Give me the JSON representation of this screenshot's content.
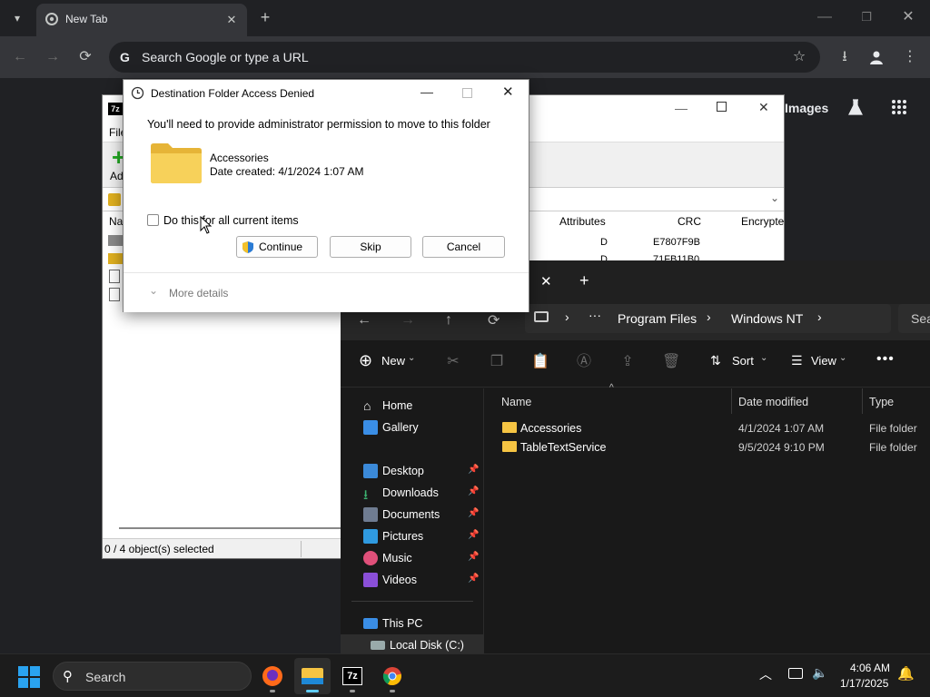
{
  "chrome": {
    "tab_title": "New Tab",
    "omnibox_placeholder": "Search Google or type a URL",
    "images_link": "Images"
  },
  "sevenzip": {
    "menu_first": "File",
    "toolbar_first_label": "Add",
    "column_name_fragment": "Na",
    "columns": [
      "Attributes",
      "CRC",
      "Encrypte"
    ],
    "rows": [
      {
        "attributes": "D",
        "crc": "E7807F9B"
      },
      {
        "attributes": "D",
        "crc": "71FB11B0"
      }
    ],
    "status": "0 / 4 object(s) selected"
  },
  "dialog": {
    "title": "Destination Folder Access Denied",
    "message": "You'll need to provide administrator permission to move to this folder",
    "folder_name": "Accessories",
    "folder_date": "Date created: 4/1/2024 1:07 AM",
    "checkbox_label": "Do this for all current items",
    "buttons": {
      "continue": "Continue",
      "skip": "Skip",
      "cancel": "Cancel"
    },
    "more_details": "More details"
  },
  "explorer": {
    "breadcrumb": [
      "Program Files",
      "Windows NT"
    ],
    "search_fragment": "Sea",
    "commands": {
      "new": "New",
      "sort": "Sort",
      "view": "View"
    },
    "nav": [
      {
        "label": "Home",
        "icon": "home-icon",
        "pinned": false
      },
      {
        "label": "Gallery",
        "icon": "gallery-icon",
        "pinned": false
      },
      {
        "label": "Desktop",
        "icon": "desktop-folder-icon",
        "pinned": true
      },
      {
        "label": "Downloads",
        "icon": "downloads-folder-icon",
        "pinned": true
      },
      {
        "label": "Documents",
        "icon": "documents-folder-icon",
        "pinned": true
      },
      {
        "label": "Pictures",
        "icon": "pictures-folder-icon",
        "pinned": true
      },
      {
        "label": "Music",
        "icon": "music-folder-icon",
        "pinned": true
      },
      {
        "label": "Videos",
        "icon": "videos-folder-icon",
        "pinned": true
      },
      {
        "label": "This PC",
        "icon": "this-pc-icon",
        "pinned": false
      },
      {
        "label": "Local Disk (C:)",
        "icon": "drive-icon",
        "pinned": false
      }
    ],
    "columns": {
      "name": "Name",
      "date": "Date modified",
      "type": "Type"
    },
    "files": [
      {
        "name": "Accessories",
        "date": "4/1/2024 1:07 AM",
        "type": "File folder"
      },
      {
        "name": "TableTextService",
        "date": "9/5/2024 9:10 PM",
        "type": "File folder"
      }
    ]
  },
  "taskbar": {
    "search_label": "Search",
    "time": "4:06 AM",
    "date": "1/17/2025",
    "apps": [
      "firefox-icon",
      "file-explorer-icon",
      "7zip-icon",
      "chrome-icon"
    ]
  },
  "colors": {
    "chrome_bg": "#35363a",
    "chrome_tabstrip": "#202124",
    "explorer_bg": "#191919",
    "folder_yellow": "#f5c443",
    "accent_blue": "#0067c0"
  }
}
